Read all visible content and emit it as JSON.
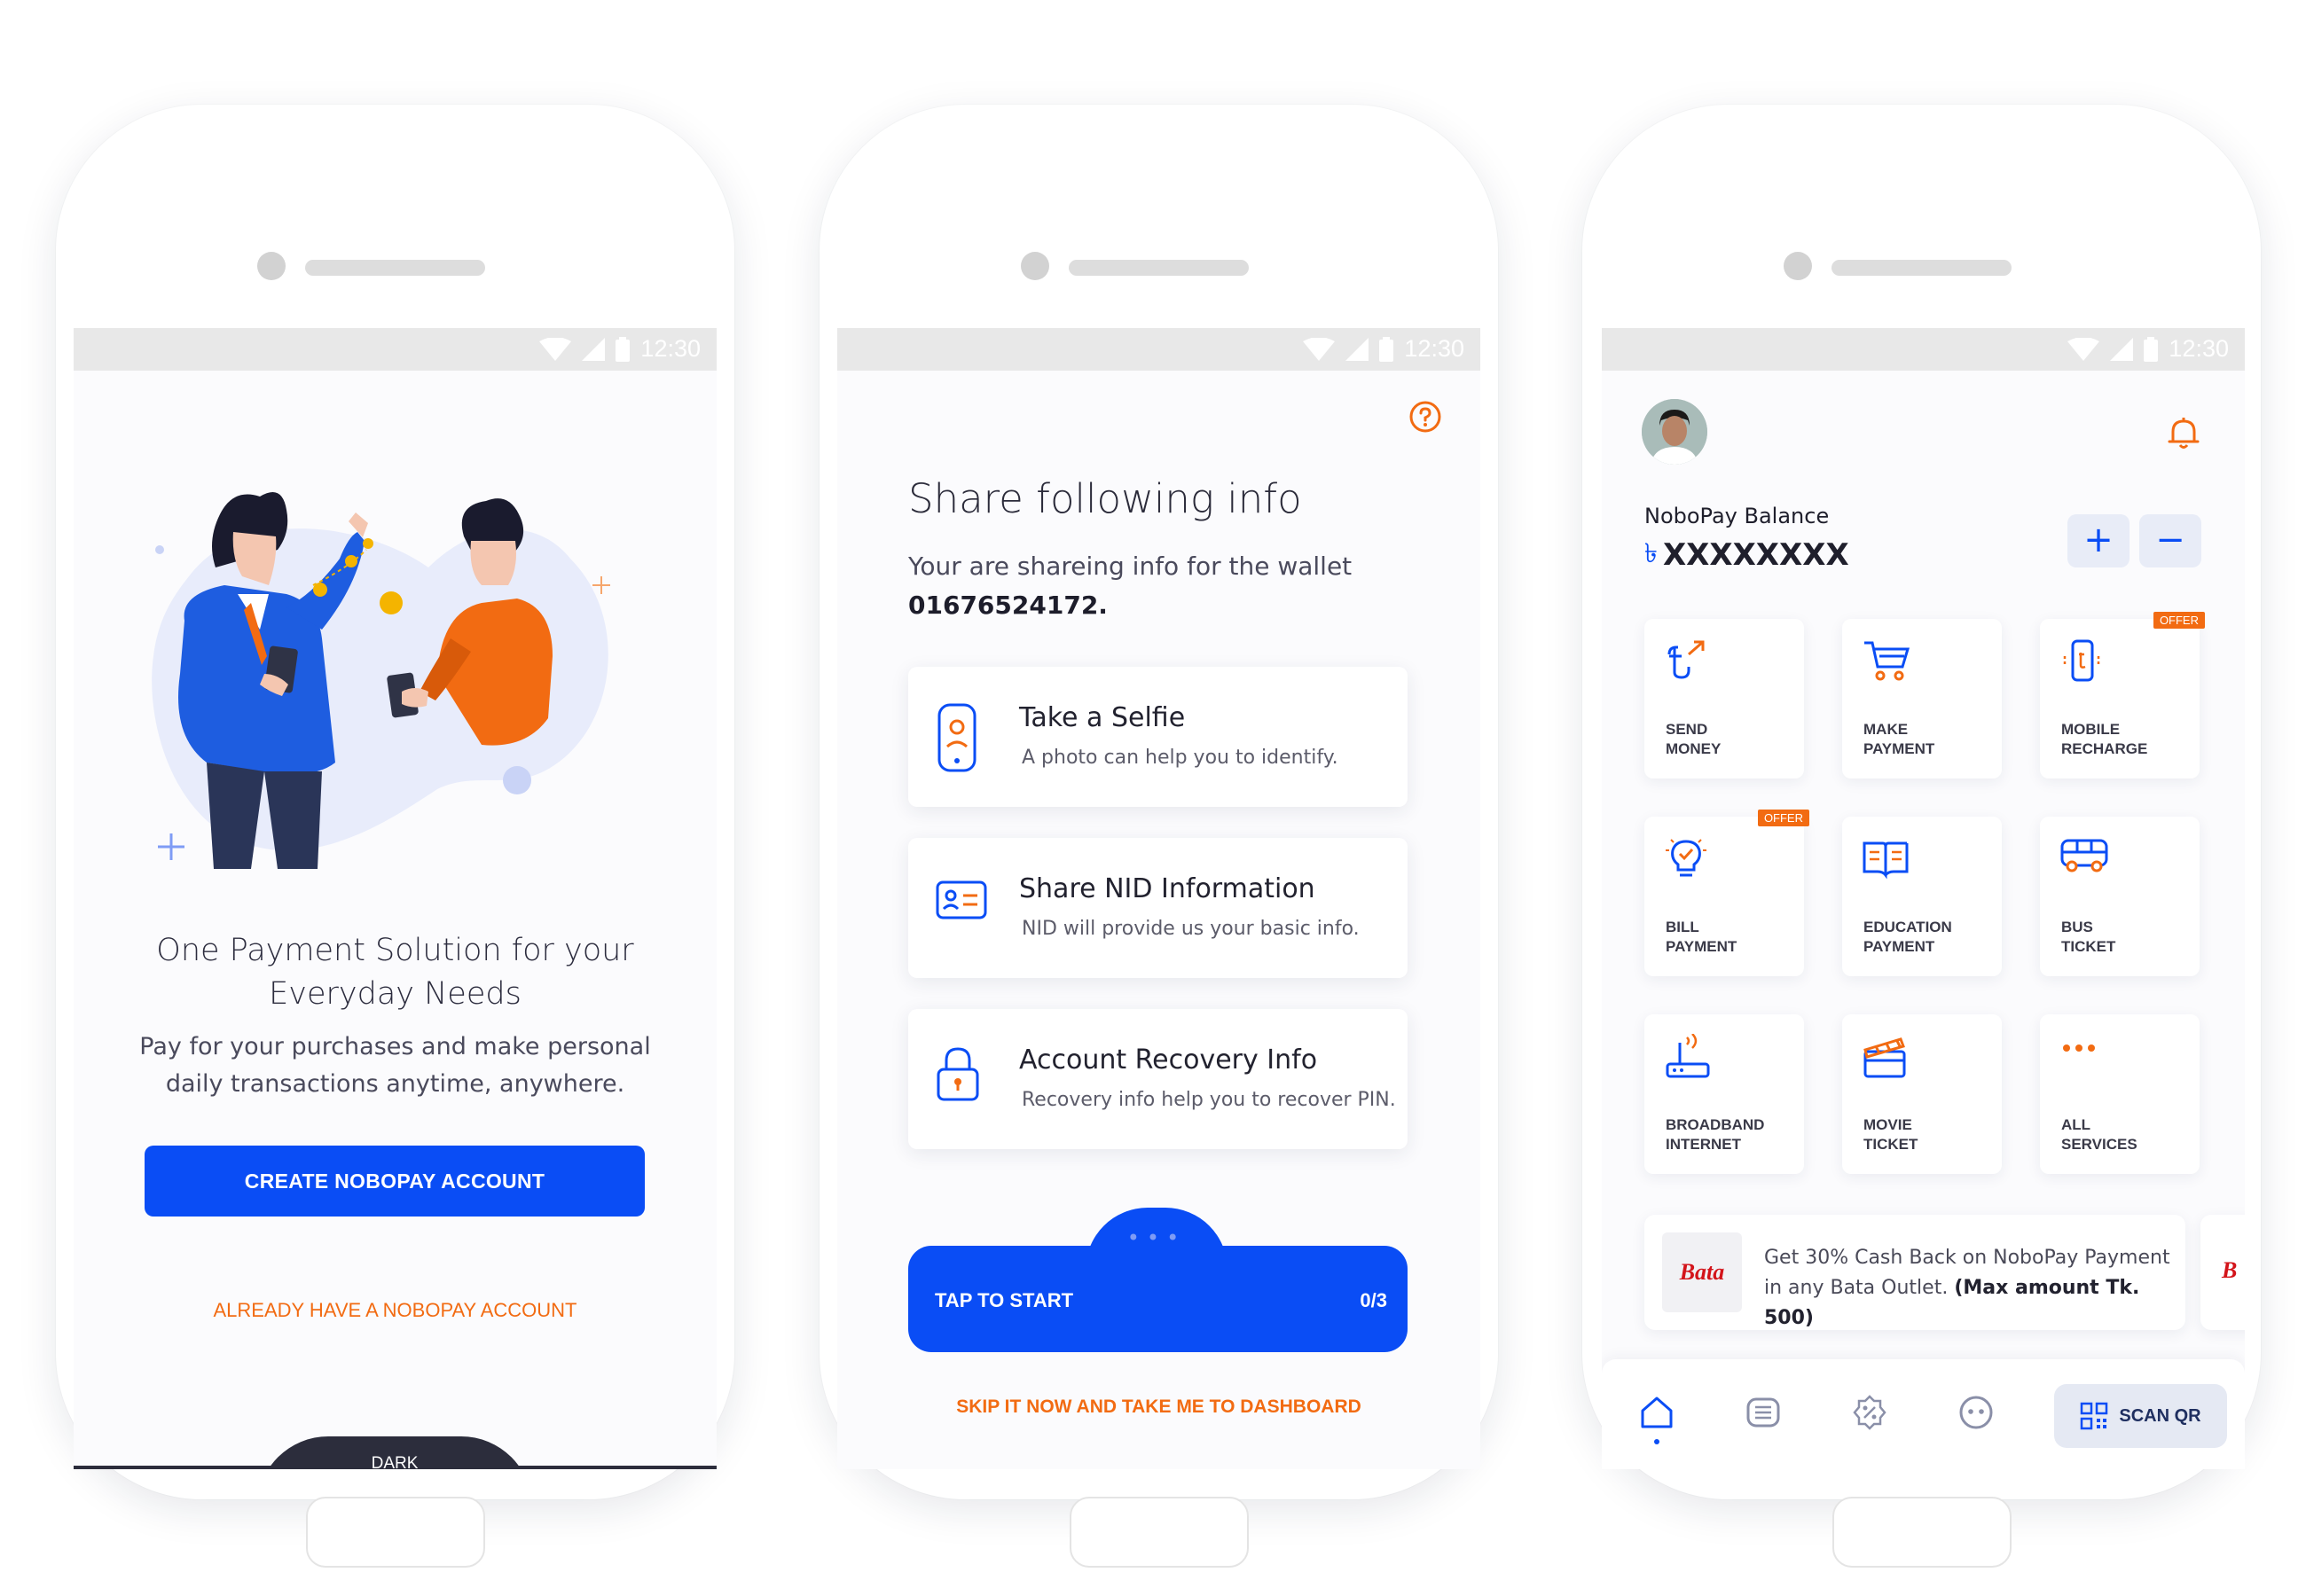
{
  "status_bar": {
    "time": "12:30"
  },
  "screen1": {
    "title_line1": "One Payment Solution for your",
    "title_line2": "Everyday Needs",
    "subtitle_line1": "Pay for your purchases and make personal",
    "subtitle_line2": "daily transactions anytime, anywhere.",
    "create_account_label": "CREATE NOBOPAY ACCOUNT",
    "already_account_label": "ALREADY HAVE A NOBOPAY ACCOUNT",
    "theme_tab_label": "DARK"
  },
  "screen2": {
    "title": "Share following info",
    "description": "Your are shareing info for the wallet",
    "wallet_number": "01676524172.",
    "cards": [
      {
        "title": "Take a Selfie",
        "description": "A photo can help you to identify.",
        "icon": "phone-selfie-icon"
      },
      {
        "title": "Share NID Information",
        "description": "NID will provide us your basic info.",
        "icon": "id-card-icon"
      },
      {
        "title": "Account Recovery Info",
        "description": "Recovery info help you to recover PIN.",
        "icon": "lock-icon"
      }
    ],
    "tap_label": "TAP TO START",
    "tap_count": "0/3",
    "skip_label": "SKIP IT NOW AND TAKE ME TO DASHBOARD"
  },
  "screen3": {
    "balance_label": "NoboPay Balance",
    "balance_value": "XXXXXXXX",
    "currency_symbol": "৳",
    "add_button": "+",
    "remove_button": "−",
    "services": [
      {
        "line1": "SEND",
        "line2": "MONEY",
        "icon": "send-money-icon"
      },
      {
        "line1": "MAKE",
        "line2": "PAYMENT",
        "icon": "cart-icon"
      },
      {
        "line1": "MOBILE",
        "line2": "RECHARGE",
        "icon": "mobile-icon",
        "badge": "OFFER"
      },
      {
        "line1": "BILL",
        "line2": "PAYMENT",
        "icon": "bulb-icon",
        "badge": "OFFER"
      },
      {
        "line1": "EDUCATION",
        "line2": "PAYMENT",
        "icon": "book-icon"
      },
      {
        "line1": "BUS",
        "line2": "TICKET",
        "icon": "bus-icon"
      },
      {
        "line1": "BROADBAND",
        "line2": "INTERNET",
        "icon": "router-icon"
      },
      {
        "line1": "MOVIE",
        "line2": "TICKET",
        "icon": "clapper-icon"
      },
      {
        "line1": "ALL",
        "line2": "SERVICES",
        "icon": "more-icon"
      }
    ],
    "promo_logo": "Bata",
    "promo_text": "Get 30% Cash Back on NoboPay Payment in any Bata Outlet.",
    "promo_bold": "(Max amount Tk. 500)",
    "promo2_logo": "B",
    "scan_label": "SCAN QR"
  },
  "colors": {
    "primary": "#0a4df5",
    "accent": "#f26b12",
    "dark": "#2c2d3c"
  }
}
